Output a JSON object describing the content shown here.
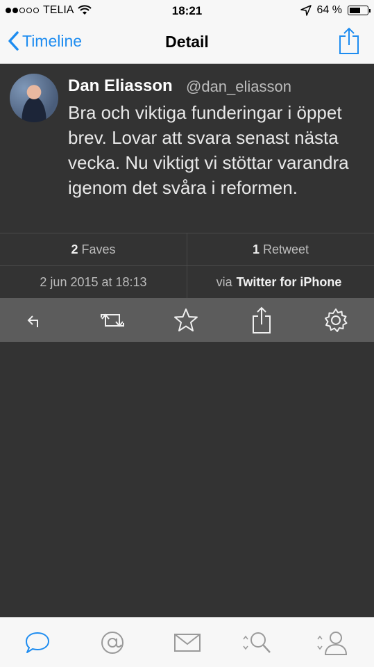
{
  "status_bar": {
    "carrier": "TELIA",
    "time": "18:21",
    "battery_percent": "64 %",
    "battery_level": 0.64,
    "signal_bars_filled": 2,
    "signal_bars_total": 5
  },
  "nav": {
    "back_label": "Timeline",
    "title": "Detail"
  },
  "tweet": {
    "author_name": "Dan Eliasson",
    "author_handle": "@dan_eliasson",
    "text": "Bra och viktiga funderingar i öppet brev. Lovar att svara senast nästa vecka. Nu viktigt vi stöttar varandra igenom det svåra i reformen.",
    "faves_count": "2",
    "faves_label": "Faves",
    "retweets_count": "1",
    "retweets_label": "Retweet",
    "timestamp": "2 jun 2015 at 18:13",
    "via_prefix": "via",
    "source": "Twitter for iPhone"
  },
  "actions": [
    "reply-icon",
    "retweet-icon",
    "star-icon",
    "share-icon",
    "gear-icon"
  ],
  "tabs": [
    "speech-bubble-icon",
    "at-sign-icon",
    "mail-icon",
    "search-icon",
    "profile-icon"
  ],
  "colors": {
    "accent": "#1d8cf0",
    "background": "#333333",
    "action_bar": "#5c5c5c",
    "chrome": "#f7f7f7"
  }
}
